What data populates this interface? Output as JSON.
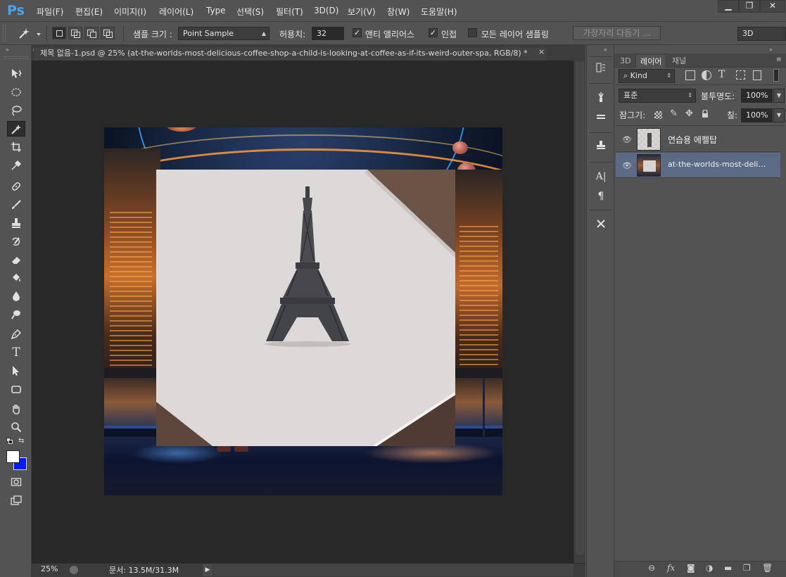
{
  "app": {
    "logo": "Ps"
  },
  "menu": {
    "items": [
      "파일(F)",
      "편집(E)",
      "이미지(I)",
      "레이어(L)",
      "Type",
      "선택(S)",
      "필터(T)",
      "3D(D)",
      "보기(V)",
      "창(W)",
      "도움말(H)"
    ]
  },
  "window_controls": {
    "minimize": "▁",
    "maximize": "❐",
    "close": "✕"
  },
  "options": {
    "sample_size_label": "샘플 크기 :",
    "sample_size_value": "Point Sample",
    "tolerance_label": "허용치:",
    "tolerance_value": "32",
    "anti_alias_label": "앤티 앨리어스",
    "anti_alias_checked": true,
    "contiguous_label": "인접",
    "contiguous_checked": true,
    "all_layers_label": "모든 레이어 샘플링",
    "all_layers_checked": false,
    "refine_edge_button": "가장자리 다듬기 ...",
    "workspace_value": "3D"
  },
  "document": {
    "tab_title": "제목 없음-1.psd @ 25% (at-the-worlds-most-delicious-coffee-shop-a-child-is-looking-at-coffee-as-if-its-weird-outer-spa, RGB/8) *",
    "close": "×",
    "zoom": "25%",
    "doc_info": "문서: 13.5M/31.3M"
  },
  "panels": {
    "tabs": [
      "3D",
      "레이어",
      "채널"
    ],
    "active_tab": "레이어",
    "filter_kind": "Kind",
    "blend_mode": "표준",
    "opacity_label": "불투명도:",
    "opacity_value": "100%",
    "lock_label": "잠그기:",
    "fill_label": "칠:",
    "fill_value": "100%"
  },
  "layers": [
    {
      "name": "연습용 에펠탑",
      "visible": true,
      "selected": false
    },
    {
      "name": "at-the-worlds-most-delicio...",
      "visible": true,
      "selected": true
    }
  ],
  "colors": {
    "foreground": "#ffffff",
    "background": "#0019ff",
    "selected_layer": "#5b6b85",
    "ps_blue": "#4aa3f0"
  },
  "icons": {
    "tools": [
      "move-icon",
      "ellipse-marquee-icon",
      "lasso-icon",
      "magic-wand-icon",
      "crop-icon",
      "eyedropper-icon",
      "healing-brush-icon",
      "brush-icon",
      "clone-stamp-icon",
      "history-brush-icon",
      "eraser-icon",
      "paint-bucket-icon",
      "blur-icon",
      "dodge-icon",
      "pen-icon",
      "type-icon",
      "path-selection-icon",
      "rectangle-icon",
      "hand-icon",
      "zoom-icon"
    ]
  }
}
